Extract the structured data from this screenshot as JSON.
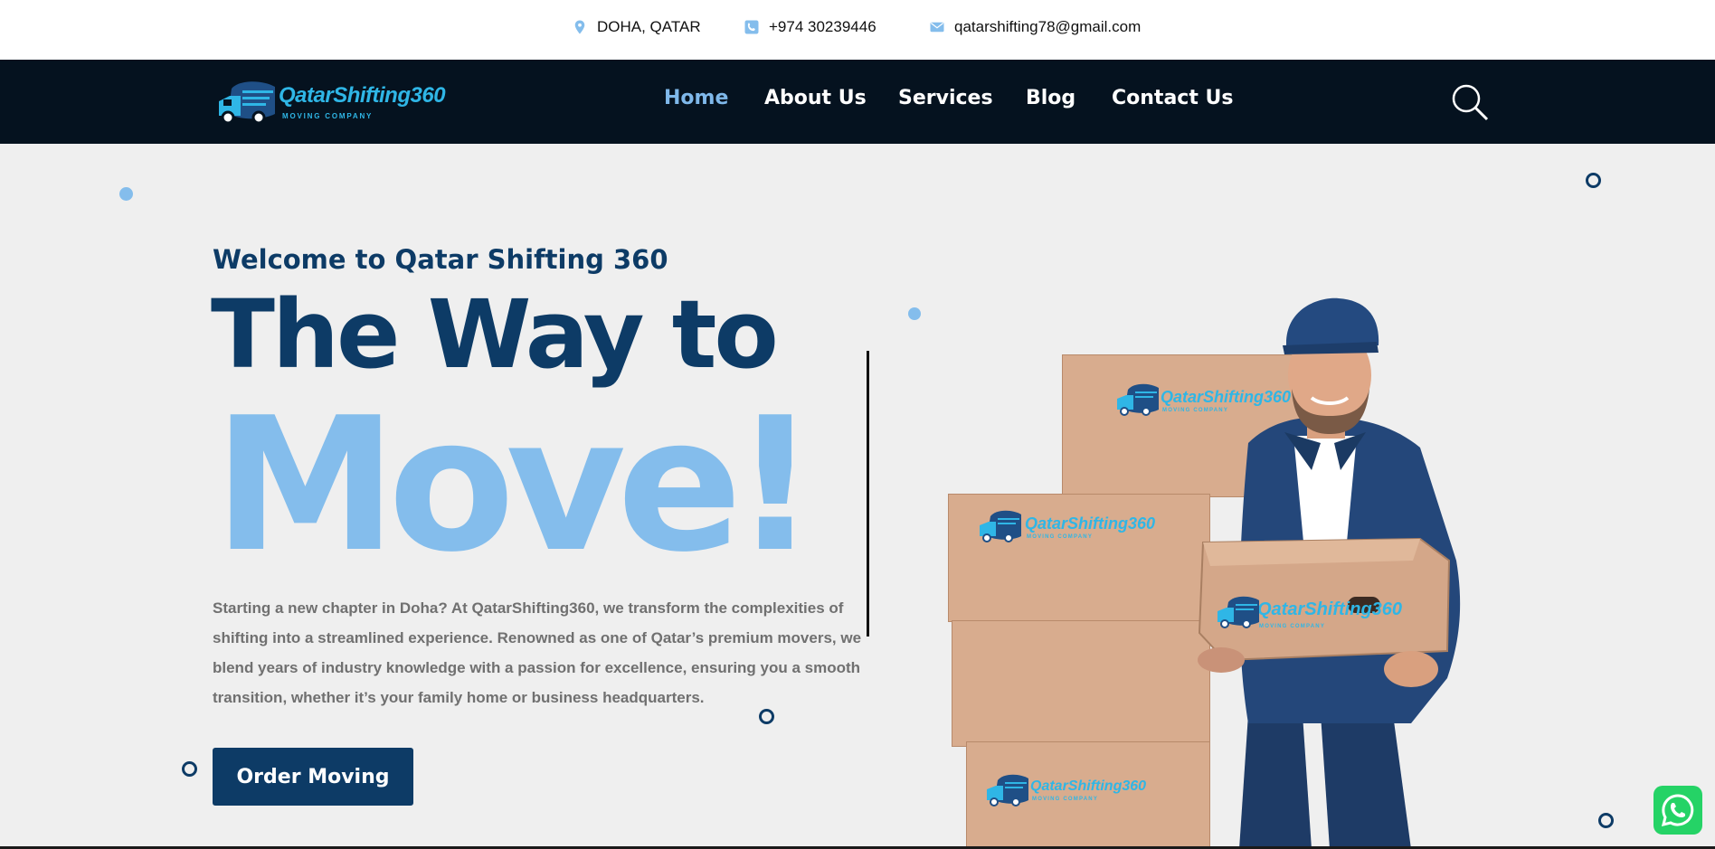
{
  "topbar": {
    "location": "DOHA, QATAR",
    "phone": "+974 30239446",
    "email": "qatarshifting78@gmail.com"
  },
  "logo": {
    "brand": "QatarShifting360",
    "tagline": "MOVING COMPANY"
  },
  "nav": {
    "items": [
      {
        "label": "Home",
        "active": true
      },
      {
        "label": "About Us",
        "active": false
      },
      {
        "label": "Services",
        "active": false
      },
      {
        "label": "Blog",
        "active": false
      },
      {
        "label": "Contact Us",
        "active": false
      }
    ]
  },
  "hero": {
    "welcome": "Welcome to Qatar Shifting 360",
    "headline_line1": "The Way to",
    "headline_line2": "Move!",
    "description": "Starting a new chapter in Doha? At QatarShifting360, we transform the complexities of shifting into a streamlined experience. Renowned as one of Qatar’s premium movers, we blend years of industry knowledge with a passion for excellence, ensuring you a smooth transition, whether it’s your family home or business headquarters.",
    "cta_label": "Order Moving"
  },
  "illustration": {
    "box_brand": "QatarShifting360",
    "box_tagline": "MOVING COMPANY"
  },
  "colors": {
    "navy": "#0d3b66",
    "light_blue": "#84bdec",
    "nav_bg": "#05121f",
    "logo_cyan": "#2fb6e6",
    "whatsapp": "#25d366"
  },
  "icons": {
    "location": "map-pin-icon",
    "phone": "phone-icon",
    "email": "envelope-icon",
    "search": "search-icon",
    "whatsapp": "whatsapp-icon"
  }
}
